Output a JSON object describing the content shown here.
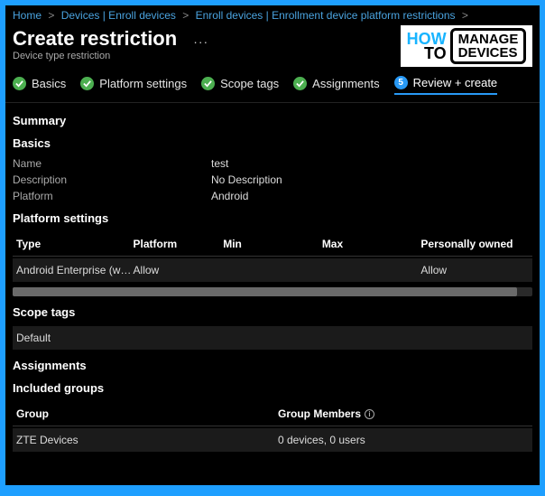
{
  "breadcrumb": {
    "items": [
      "Home",
      "Devices | Enroll devices",
      "Enroll devices | Enrollment device platform restrictions"
    ]
  },
  "page": {
    "title": "Create restriction",
    "subtitle": "Device type restriction"
  },
  "tabs": {
    "basics": "Basics",
    "platform": "Platform settings",
    "scope": "Scope tags",
    "assign": "Assignments",
    "review": "Review + create",
    "review_num": "5"
  },
  "sections": {
    "summary": "Summary",
    "basics": "Basics",
    "platform_settings": "Platform settings",
    "scope_tags": "Scope tags",
    "assignments": "Assignments",
    "included_groups": "Included groups"
  },
  "basics": {
    "name_label": "Name",
    "name_value": "test",
    "desc_label": "Description",
    "desc_value": "No Description",
    "plat_label": "Platform",
    "plat_value": "Android"
  },
  "ps_headers": {
    "type": "Type",
    "platform": "Platform",
    "min": "Min",
    "max": "Max",
    "own": "Personally owned"
  },
  "ps_row": {
    "type": "Android Enterprise (w…",
    "platform": "Allow",
    "min": "",
    "max": "",
    "own": "Allow"
  },
  "scope_tags": {
    "default": "Default"
  },
  "groups_headers": {
    "group": "Group",
    "members": "Group Members"
  },
  "groups_row": {
    "group": "ZTE Devices",
    "members": "0 devices, 0 users"
  },
  "logo": {
    "how": "HOW",
    "to": "TO",
    "manage": "MANAGE",
    "devices": "DEVICES"
  }
}
